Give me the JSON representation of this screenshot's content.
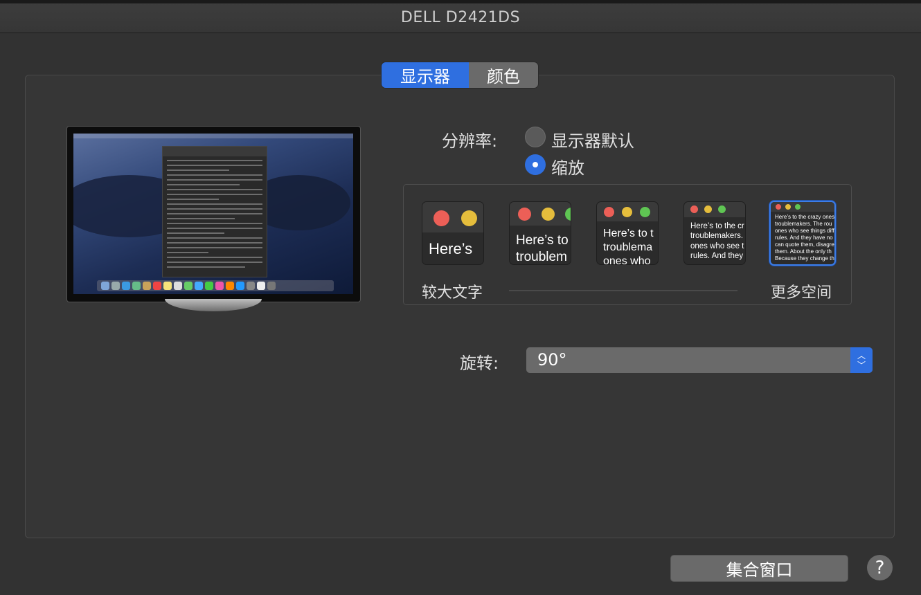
{
  "window": {
    "title": "DELL D2421DS"
  },
  "tabs": [
    {
      "label": "显示器",
      "active": true
    },
    {
      "label": "颜色",
      "active": false
    }
  ],
  "resolution": {
    "label": "分辨率:",
    "options": [
      {
        "label": "显示器默认",
        "selected": false
      },
      {
        "label": "缩放",
        "selected": true
      }
    ]
  },
  "scaling": {
    "left_label": "较大文字",
    "right_label": "更多空间",
    "thumbs": [
      {
        "text": "Here’s",
        "selected": false
      },
      {
        "text": "Here’s to\ntroublem",
        "selected": false
      },
      {
        "text": "Here’s to t\ntroublema\nones who",
        "selected": false
      },
      {
        "text": "Here’s to the cr\ntroublemakers.\nones who see t\nrules. And they",
        "selected": false
      },
      {
        "text": "Here’s to the crazy ones\ntroublemakers. The rou\nones who see things diff\nrules. And they have no\ncan quote them, disagre\nthem. About the only th\nBecause they change th",
        "selected": true
      }
    ]
  },
  "rotation": {
    "label": "旋转:",
    "value": "90°"
  },
  "footer": {
    "gather_windows_label": "集合窗口",
    "help_label": "?"
  },
  "colors": {
    "accent": "#2f6fe0",
    "background": "#323232",
    "control": "#6a6a6a"
  }
}
